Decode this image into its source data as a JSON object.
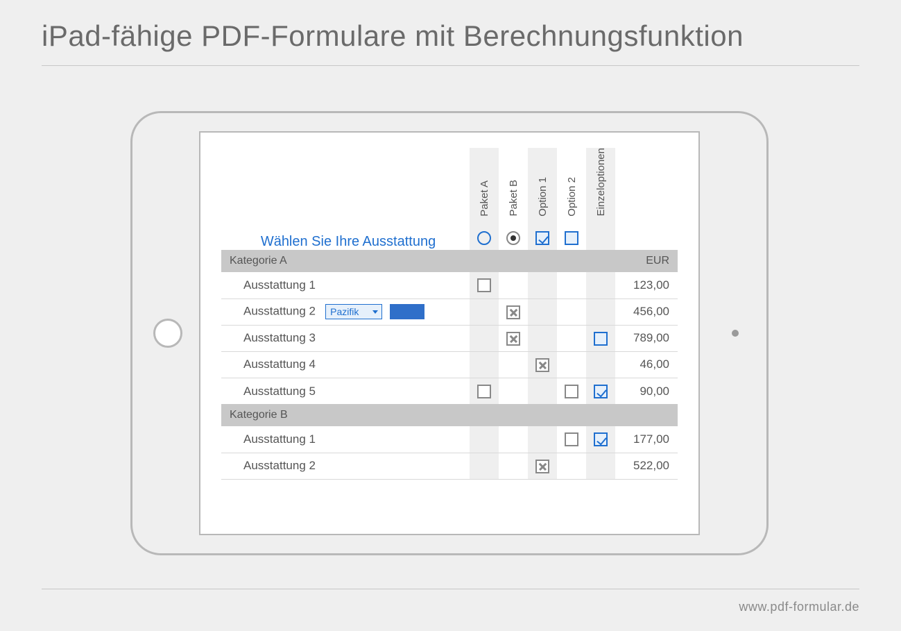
{
  "title": "iPad-fähige PDF-Formulare mit Berechnungsfunktion",
  "footer": "www.pdf-formular.de",
  "form": {
    "instruction": "Wählen Sie Ihre Ausstattung",
    "headers": {
      "paket_a": "Paket A",
      "paket_b": "Paket B",
      "option_1": "Option 1",
      "option_2": "Option 2",
      "einzel": "Einzeloptionen"
    },
    "header_controls": {
      "paket_a": "radio-empty-blue",
      "paket_b": "radio-filled-grey",
      "option_1": "checkbox-blue-check",
      "option_2": "checkbox-blue-empty"
    },
    "currency": "EUR",
    "categories": [
      {
        "name": "Kategorie A",
        "items": [
          {
            "label": "Ausstattung 1",
            "price": "123,00",
            "cells": {
              "paket_a": "checkbox-empty",
              "paket_b": null,
              "option_1": null,
              "option_2": null,
              "einzel": null
            }
          },
          {
            "label": "Ausstattung 2",
            "price": "456,00",
            "dropdown_value": "Pazifik",
            "swatch_color": "#2f6fc9",
            "cells": {
              "paket_a": null,
              "paket_b": "checkbox-x",
              "option_1": null,
              "option_2": null,
              "einzel": null
            }
          },
          {
            "label": "Ausstattung 3",
            "price": "789,00",
            "cells": {
              "paket_a": null,
              "paket_b": "checkbox-x",
              "option_1": null,
              "option_2": null,
              "einzel": "checkbox-blue-empty"
            }
          },
          {
            "label": "Ausstattung 4",
            "price": "46,00",
            "cells": {
              "paket_a": null,
              "paket_b": null,
              "option_1": "checkbox-x",
              "option_2": null,
              "einzel": null
            }
          },
          {
            "label": "Ausstattung 5",
            "price": "90,00",
            "cells": {
              "paket_a": "checkbox-empty",
              "paket_b": null,
              "option_1": null,
              "option_2": "checkbox-empty",
              "einzel": "checkbox-blue-check"
            }
          }
        ]
      },
      {
        "name": "Kategorie B",
        "items": [
          {
            "label": "Ausstattung 1",
            "price": "177,00",
            "cells": {
              "paket_a": null,
              "paket_b": null,
              "option_1": null,
              "option_2": "checkbox-empty",
              "einzel": "checkbox-blue-check"
            }
          },
          {
            "label": "Ausstattung 2",
            "price": "522,00",
            "cells": {
              "paket_a": null,
              "paket_b": null,
              "option_1": "checkbox-x",
              "option_2": null,
              "einzel": null
            }
          }
        ]
      }
    ]
  }
}
